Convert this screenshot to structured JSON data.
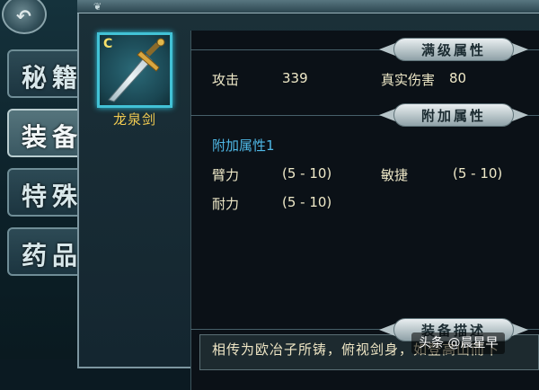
{
  "nav": {
    "back_icon": "back-arrow-icon",
    "tabs": [
      {
        "label": "秘籍"
      },
      {
        "label": "装备"
      },
      {
        "label": "特殊物"
      },
      {
        "label": "药品"
      }
    ]
  },
  "item": {
    "grade": "C",
    "name": "龙泉剑",
    "icon": "sword-icon"
  },
  "sections": {
    "max_level": "满级属性",
    "bonus": "附加属性",
    "description": "装备描述"
  },
  "max_level_stats": {
    "attack_label": "攻击",
    "attack_value": "339",
    "true_damage_label": "真实伤害",
    "true_damage_value": "80"
  },
  "bonus_stats": {
    "group_title": "附加属性1",
    "rows": [
      {
        "label": "臂力",
        "value": "(5 - 10)"
      },
      {
        "label": "敏捷",
        "value": "(5 - 10)"
      },
      {
        "label": "耐力",
        "value": "(5 - 10)"
      }
    ]
  },
  "description_text": "相传为欧冶子所铸，俯视剑身，如登高山而下",
  "watermark": "头条 @晨星早",
  "colors": {
    "item_name": "#f2cc52",
    "bonus_title": "#4fb8e6",
    "slot_border": "#42c2d6"
  }
}
